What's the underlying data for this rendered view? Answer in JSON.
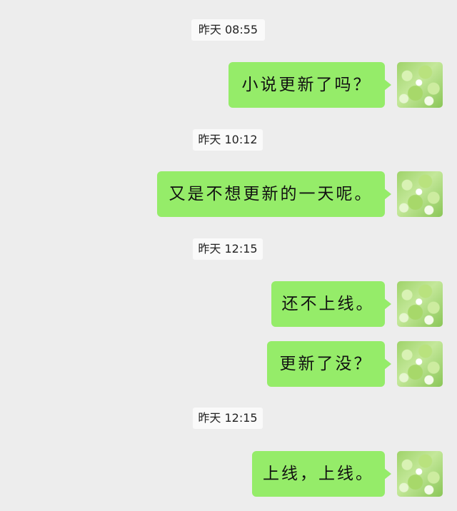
{
  "messages": [
    {
      "time": "昨天 08:55",
      "text": "小说更新了吗？"
    },
    {
      "time": "昨天 10:12",
      "text": "又是不想更新的一天呢。"
    },
    {
      "time": "昨天 12:15",
      "text": "还不上线。"
    },
    {
      "text": "更新了没？"
    },
    {
      "time": "昨天 12:15",
      "text": "上线，上线。"
    }
  ],
  "colors": {
    "background": "#ededed",
    "bubble": "#95ec69",
    "timestamp_bg": "#fafafa"
  },
  "icons": {
    "avatar": "green-floral-avatar"
  }
}
